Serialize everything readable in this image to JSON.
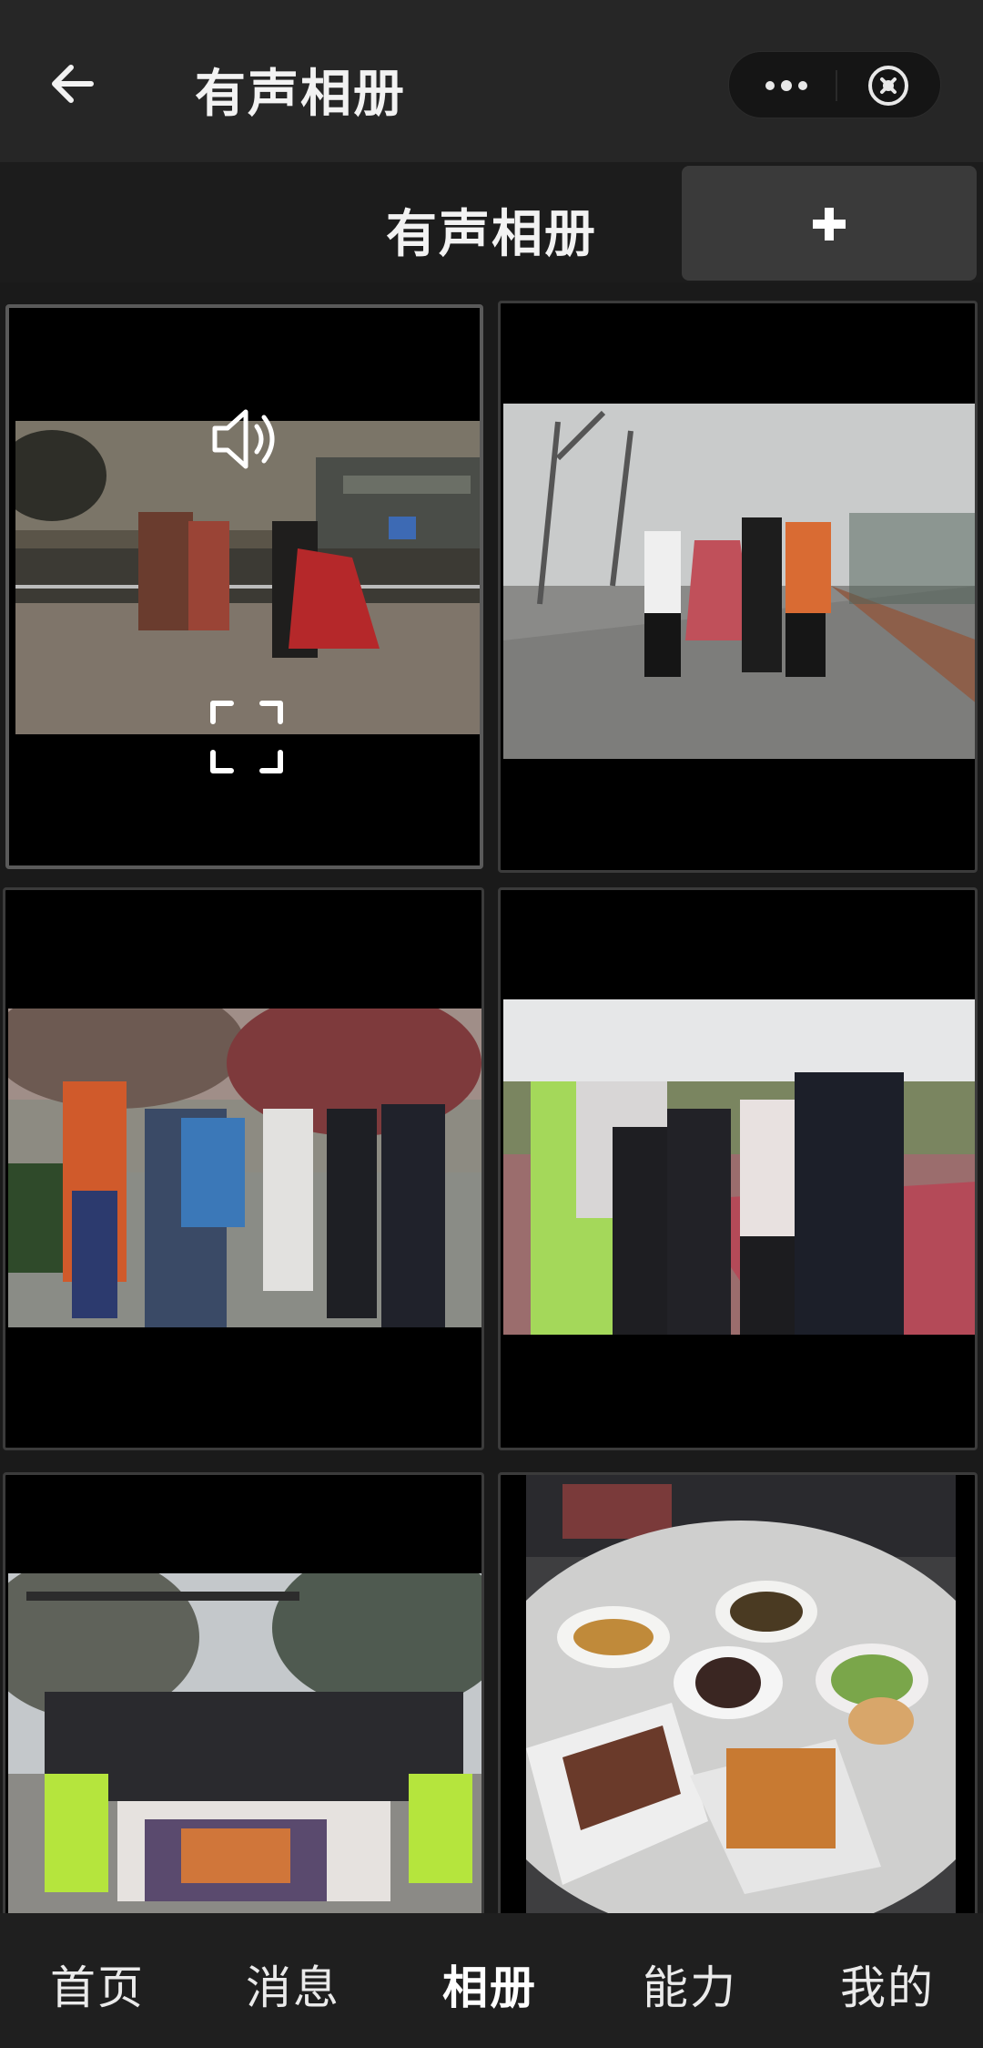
{
  "header": {
    "title": "有声相册",
    "back_icon": "arrow-left-icon",
    "more_icon": "more-dots-icon",
    "close_icon": "close-circle-icon"
  },
  "album": {
    "title": "有声相册",
    "add_icon": "plus-icon"
  },
  "photos": [
    {
      "kind": "video",
      "description_icon": "speaker-icon",
      "fullscreen_icon": "fullscreen-icon",
      "selected": true
    },
    {
      "kind": "photo",
      "selected": false
    },
    {
      "kind": "photo",
      "selected": false
    },
    {
      "kind": "photo",
      "selected": false
    },
    {
      "kind": "photo",
      "selected": false
    },
    {
      "kind": "photo",
      "selected": false
    }
  ],
  "tabs": [
    {
      "label": "首页",
      "active": false
    },
    {
      "label": "消息",
      "active": false
    },
    {
      "label": "相册",
      "active": true
    },
    {
      "label": "能力",
      "active": false
    },
    {
      "label": "我的",
      "active": false
    }
  ],
  "colors": {
    "background": "#161616",
    "topbar": "#262626",
    "add_button": "#3a3a3a"
  }
}
